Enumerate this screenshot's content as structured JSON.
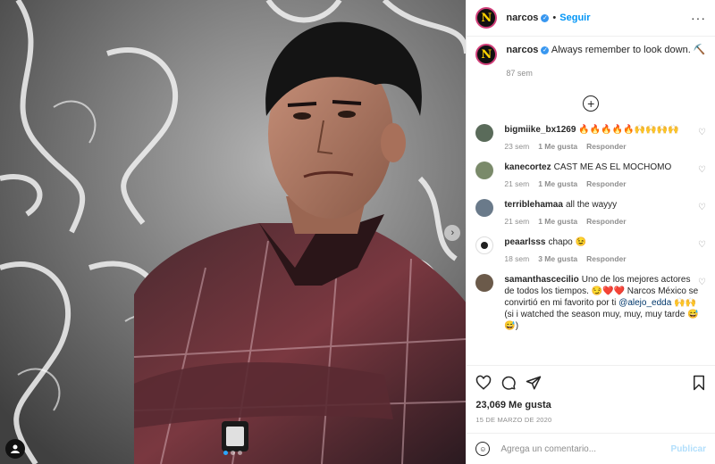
{
  "account": {
    "username": "narcos",
    "follow_label": "Seguir",
    "avatar_letter": "N"
  },
  "caption": {
    "username": "narcos",
    "text": "Always remember to look down. ⛏️",
    "age": "87 sem"
  },
  "comments": [
    {
      "username": "bigmiike_bx1269",
      "text": "🔥🔥🔥🔥🔥🙌🙌🙌🙌",
      "age": "23 sem",
      "likes": "1 Me gusta",
      "reply": "Responder",
      "avatar_color": "#5a6b5a"
    },
    {
      "username": "kanecortez",
      "text": "CAST ME AS EL MOCHOMO",
      "age": "21 sem",
      "likes": "1 Me gusta",
      "reply": "Responder",
      "avatar_color": "#7a8a6a"
    },
    {
      "username": "terriblehamaa",
      "text": "all the wayyy",
      "age": "21 sem",
      "likes": "1 Me gusta",
      "reply": "Responder",
      "avatar_color": "#6a7a8a"
    },
    {
      "username": "peaarlsss",
      "text": "chapo 😉",
      "age": "18 sem",
      "likes": "3 Me gusta",
      "reply": "Responder",
      "avatar_color": "#ffffff"
    },
    {
      "username": "samanthascecilio",
      "text": "Uno de los mejores actores de todos los tiempos. 😏❤️❤️ Narcos México se convirtió en mi favorito por ti",
      "mention": "@alejo_edda",
      "text2": "🙌🙌 (si i watched the season muy, muy, muy tarde 😅😅)",
      "age": "",
      "likes": "",
      "reply": "",
      "avatar_color": "#6b5a4a"
    }
  ],
  "stats": {
    "likes": "23,069 Me gusta",
    "date": "15 DE MARZO DE 2020"
  },
  "add_comment": {
    "placeholder": "Agrega un comentario...",
    "post_label": "Publicar"
  },
  "colors": {
    "accent": "#0095f6",
    "verified": "#3897f0",
    "muted": "#8e8e8e"
  }
}
